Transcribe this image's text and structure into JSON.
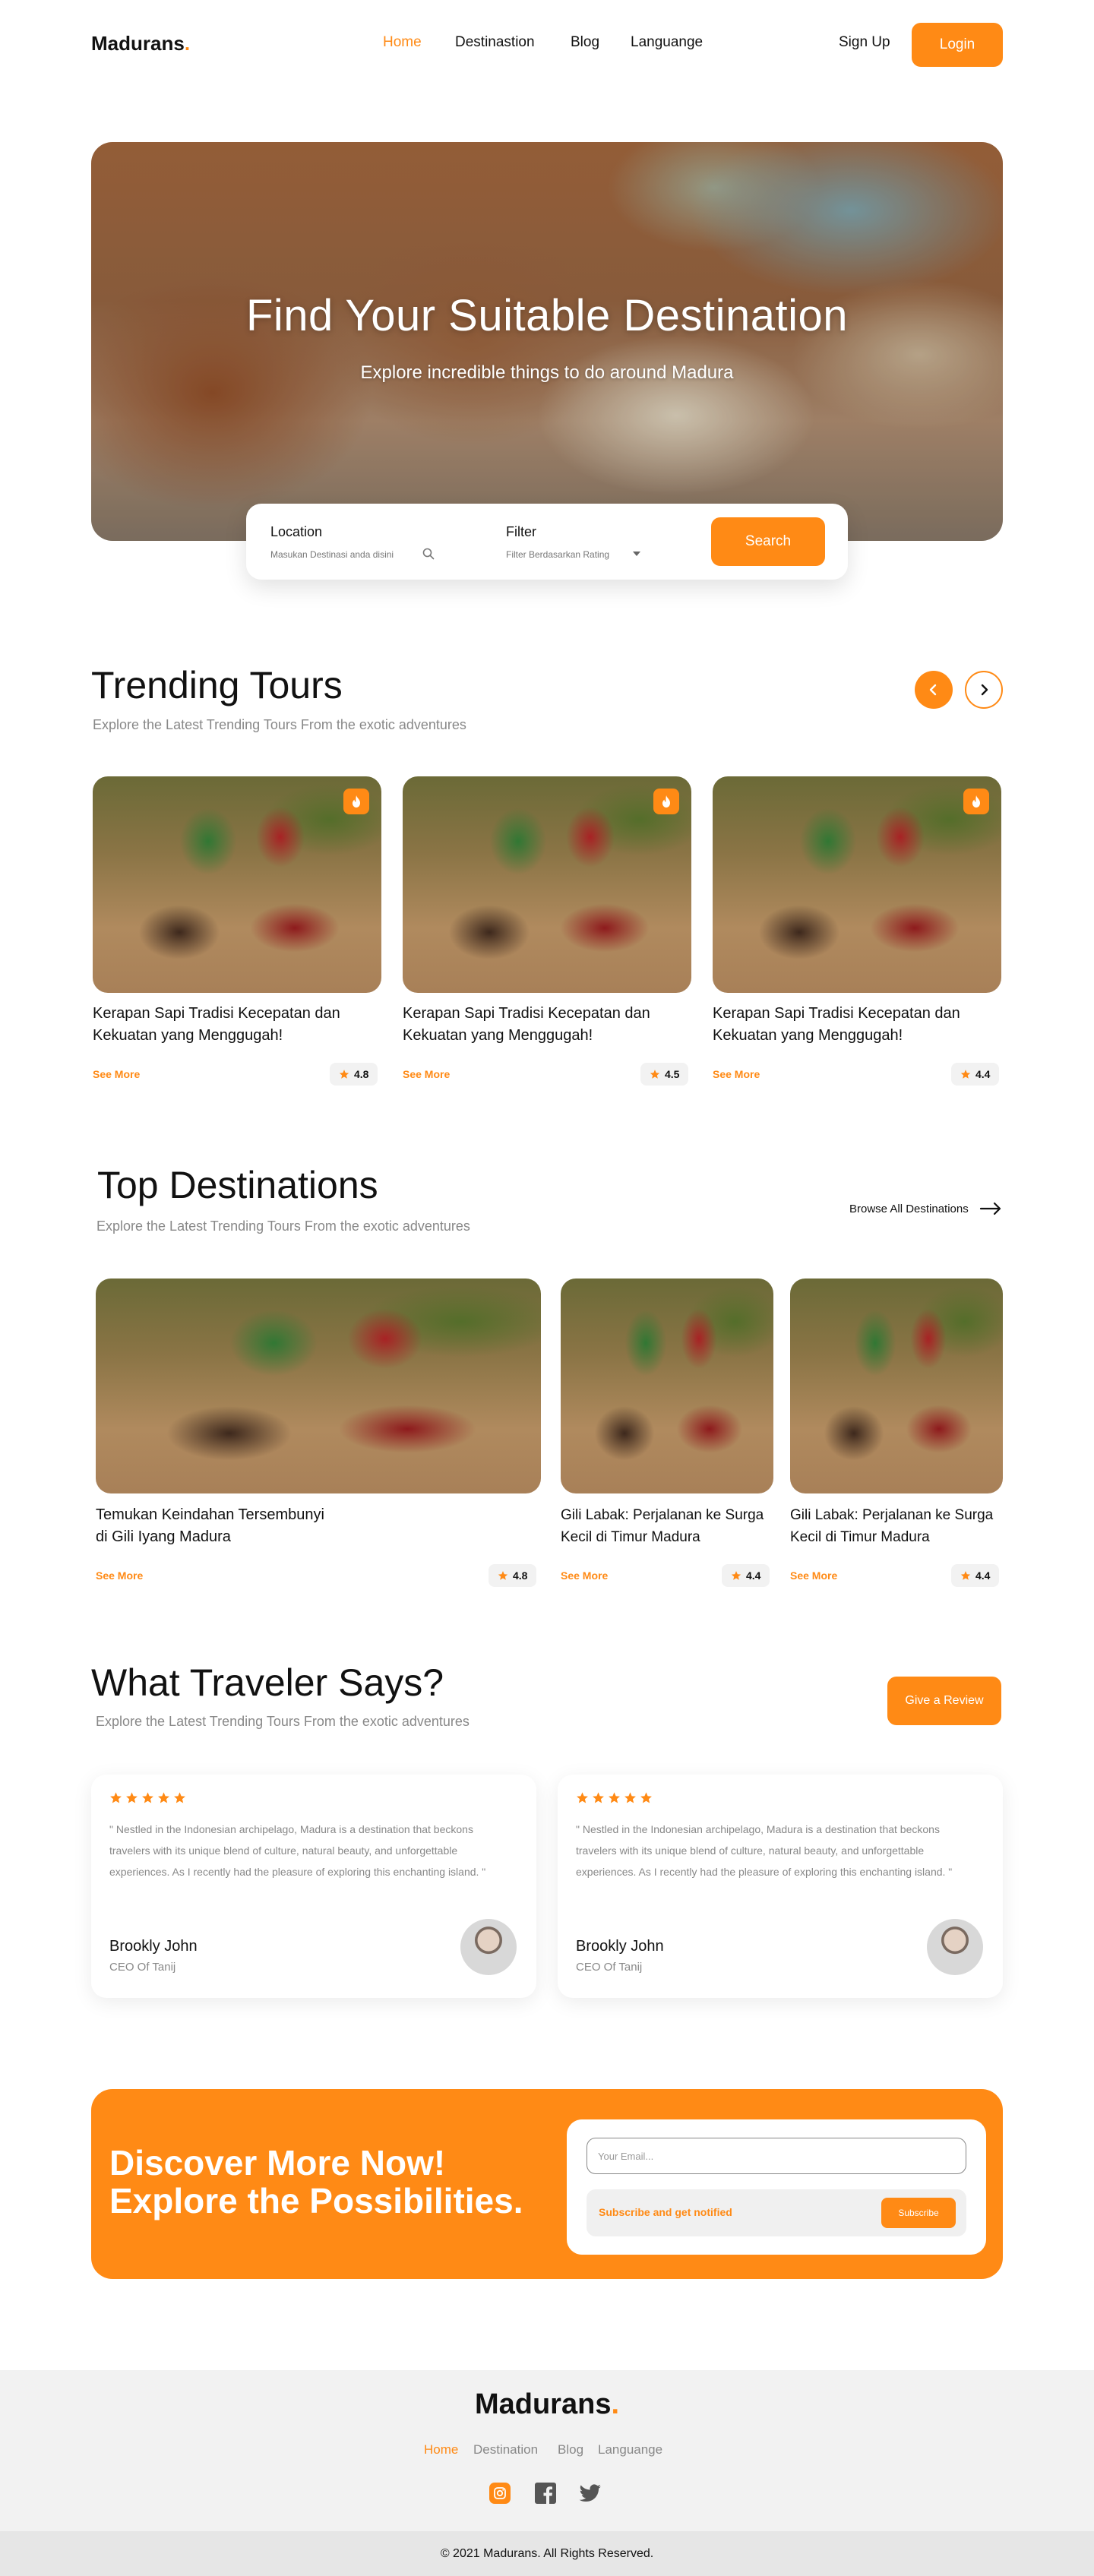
{
  "brand": {
    "name": "Madurans",
    "dot": "."
  },
  "nav": {
    "links": [
      "Home",
      "Destinastion",
      "Blog",
      "Languange"
    ],
    "signup": "Sign Up",
    "login": "Login"
  },
  "hero": {
    "title": "Find Your Suitable Destination",
    "subtitle": "Explore incredible things to do around Madura"
  },
  "search": {
    "location_label": "Location",
    "location_placeholder": "Masukan Destinasi anda disini",
    "filter_label": "Filter",
    "filter_value": "Filter Berdasarkan Rating",
    "button": "Search"
  },
  "trending": {
    "title": "Trending Tours",
    "subtitle": "Explore the Latest Trending Tours From the exotic adventures",
    "cards": [
      {
        "title_line1": "Kerapan Sapi Tradisi Kecepatan dan",
        "title_line2": "Kekuatan yang Menggugah!",
        "link": "See More",
        "rating": "4.8"
      },
      {
        "title_line1": "Kerapan Sapi Tradisi Kecepatan dan",
        "title_line2": "Kekuatan yang Menggugah!",
        "link": "See More",
        "rating": "4.5"
      },
      {
        "title_line1": "Kerapan Sapi Tradisi Kecepatan dan",
        "title_line2": "Kekuatan yang Menggugah!",
        "link": "See More",
        "rating": "4.4"
      }
    ]
  },
  "top": {
    "title": "Top Destinations",
    "subtitle": "Explore the Latest Trending Tours From the exotic adventures",
    "browse": "Browse All Destinations",
    "cards": [
      {
        "title_line1": "Temukan Keindahan Tersembunyi",
        "title_line2": "di Gili Iyang Madura",
        "link": "See More",
        "rating": "4.8"
      },
      {
        "title_line1": "Gili Labak: Perjalanan ke Surga",
        "title_line2": "Kecil di Timur Madura",
        "link": "See More",
        "rating": "4.4"
      },
      {
        "title_line1": "Gili Labak: Perjalanan ke Surga",
        "title_line2": "Kecil di Timur Madura",
        "link": "See More",
        "rating": "4.4"
      }
    ]
  },
  "reviews": {
    "title": "What Traveler Says?",
    "subtitle": "Explore the Latest Trending Tours From the exotic adventures",
    "button": "Give a Review",
    "items": [
      {
        "text": "\" Nestled in the Indonesian archipelago, Madura is a destination that beckons travelers with its unique blend of culture, natural beauty, and unforgettable experiences. As I recently had the pleasure of exploring this enchanting island. \"",
        "name": "Brookly John",
        "role": "CEO Of Tanij",
        "stars": 5
      },
      {
        "text": "\" Nestled in the Indonesian archipelago, Madura is a destination that beckons travelers with its unique blend of culture, natural beauty, and unforgettable experiences. As I recently had the pleasure of exploring this enchanting island. \"",
        "name": "Brookly John",
        "role": "CEO Of Tanij",
        "stars": 5
      }
    ]
  },
  "cta": {
    "line1": "Discover More Now!",
    "line2": "Explore the Possibilities.",
    "email_placeholder": "Your Email...",
    "notify_text": "Subscribe and get notified",
    "button": "Subscribe"
  },
  "footer": {
    "links": [
      "Home",
      "Destination",
      "Blog",
      "Languange"
    ],
    "social": [
      "instagram-icon",
      "facebook-icon",
      "twitter-icon"
    ],
    "copyright": "© 2021 Madurans. All Rights Reserved."
  },
  "colors": {
    "accent": "#FF8A15",
    "text": "#111111",
    "muted": "#888888"
  }
}
